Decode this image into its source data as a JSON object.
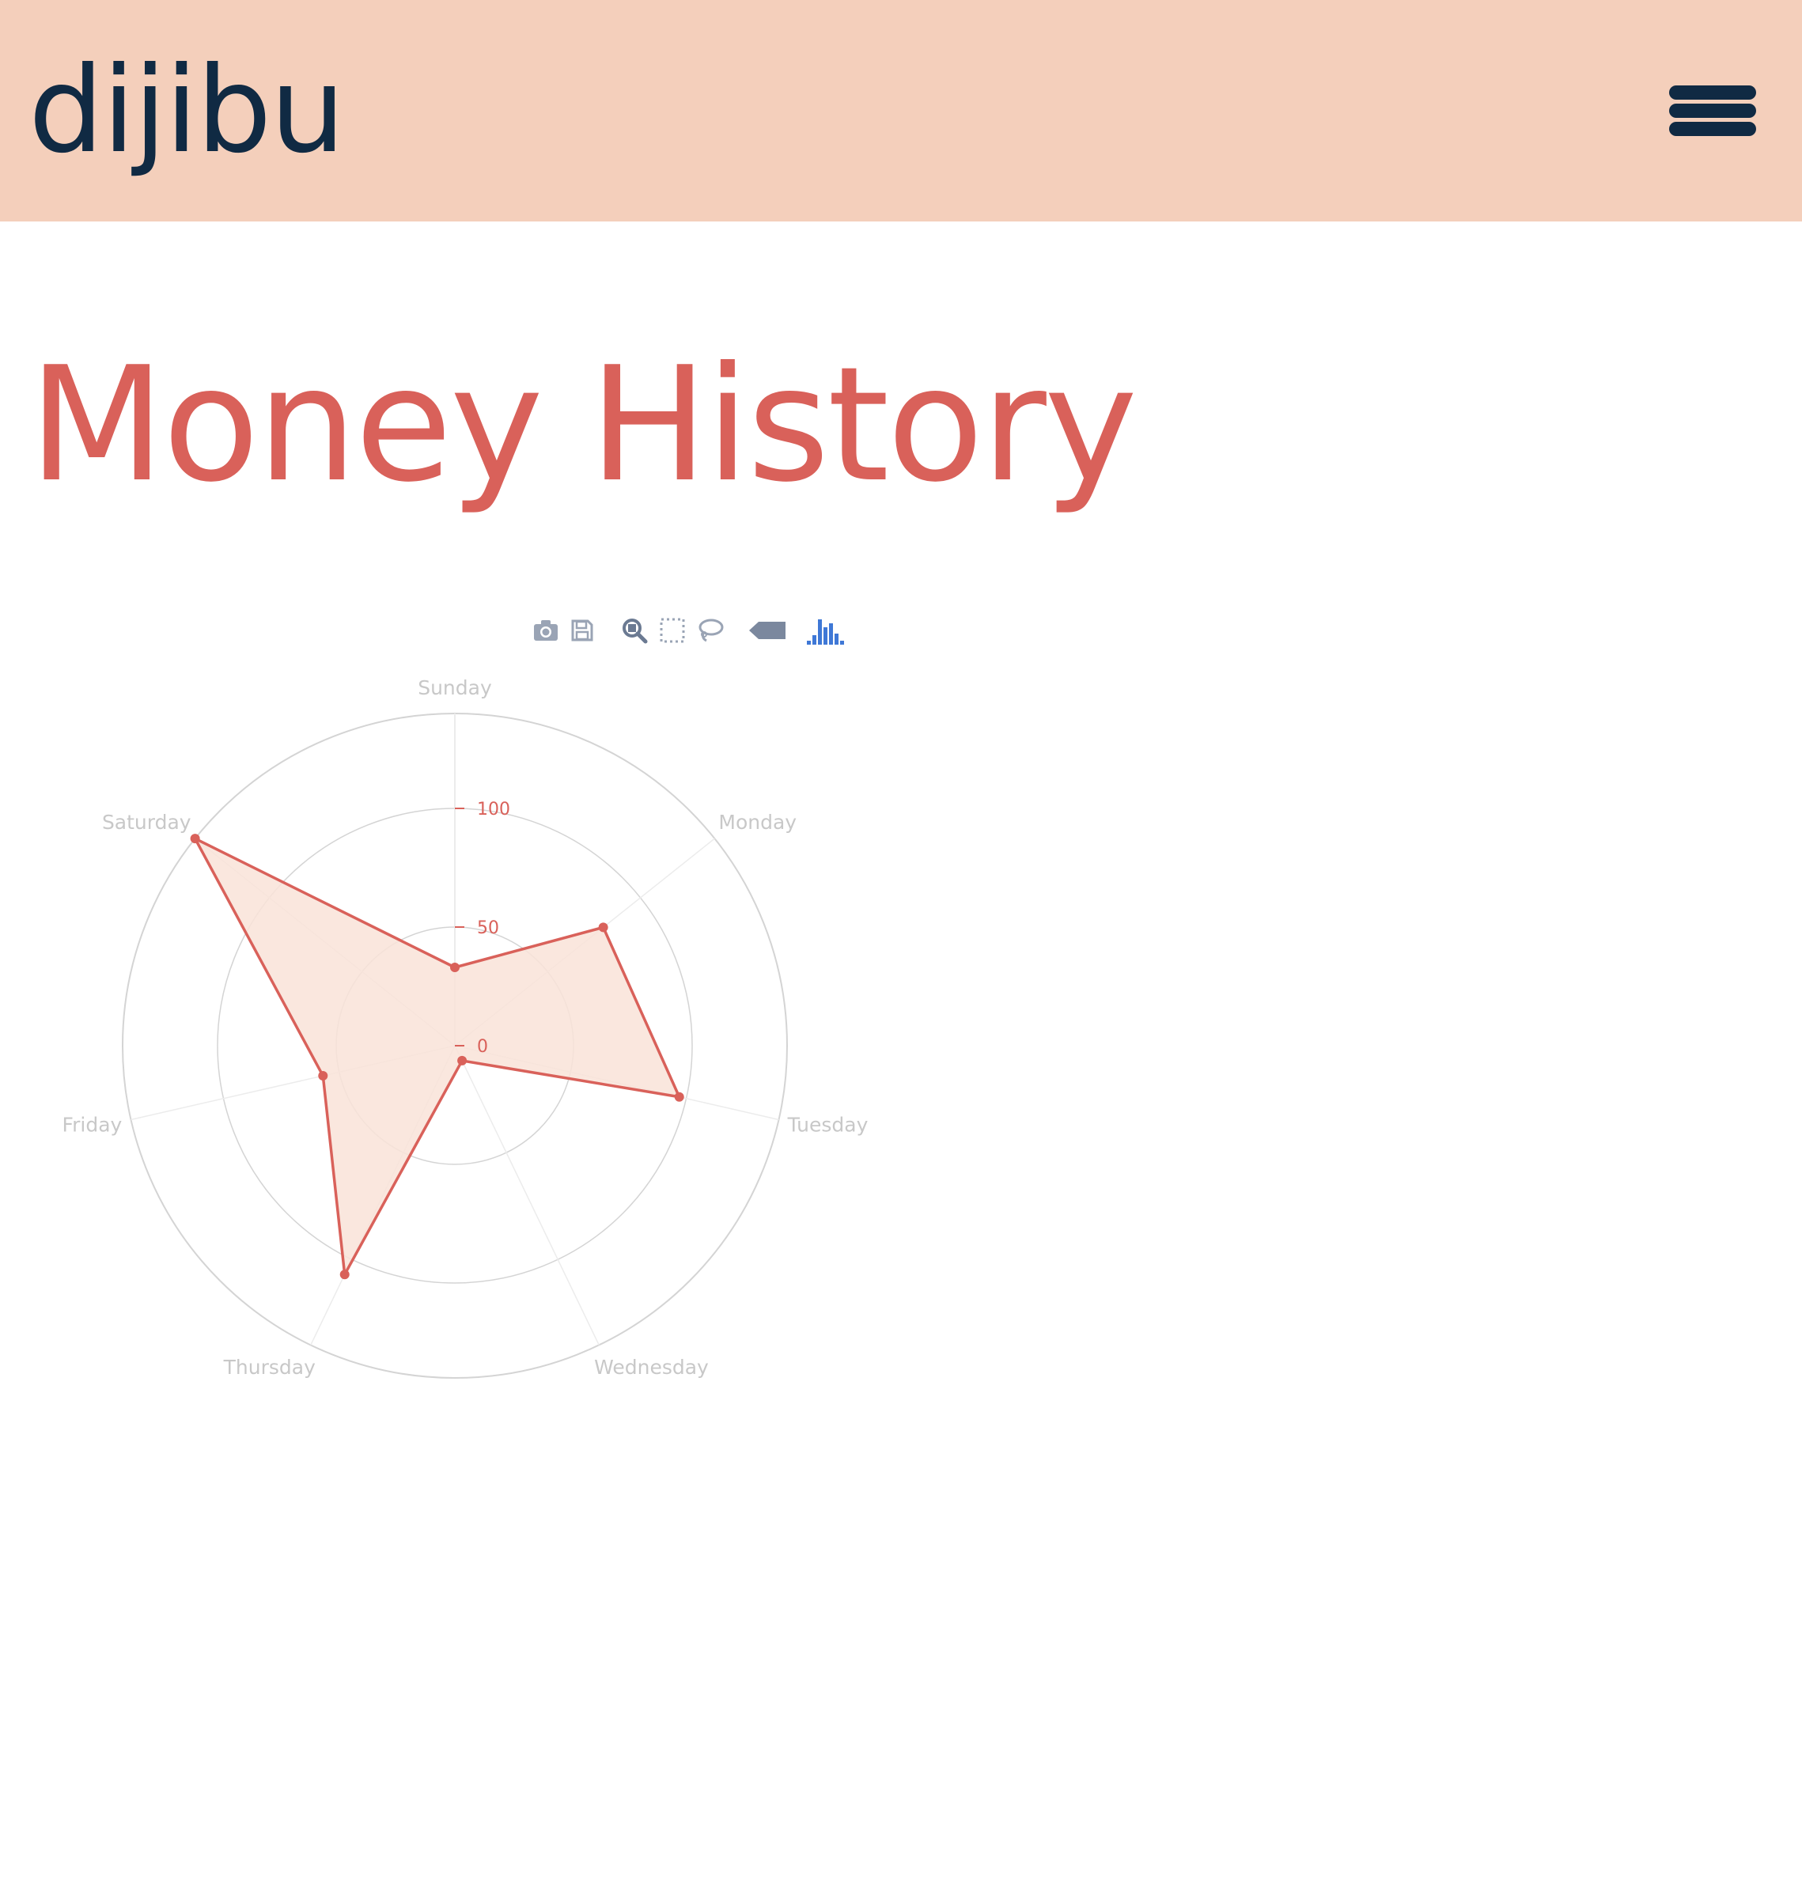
{
  "header": {
    "logo": "dijibu",
    "menu_icon": "hamburger-menu-icon"
  },
  "main": {
    "title": "Money History"
  },
  "toolbar": {
    "buttons": [
      {
        "icon": "camera-icon",
        "action": "download-plot"
      },
      {
        "icon": "save-icon",
        "action": "save"
      },
      {
        "icon": "zoom-icon",
        "action": "zoom"
      },
      {
        "icon": "box-select-icon",
        "action": "box-select"
      },
      {
        "icon": "lasso-select-icon",
        "action": "lasso-select"
      },
      {
        "icon": "hover-closest-icon",
        "action": "hover-closest"
      },
      {
        "icon": "plotly-logo-icon",
        "action": "plotly-link"
      }
    ]
  },
  "colors": {
    "header_bg": "#f4cfbb",
    "logo": "#102a43",
    "accent": "#d9615a",
    "fill": "#f9e3d8",
    "grid": "#d4d4d4",
    "axis_label": "#c8c8c8"
  },
  "chart_data": {
    "type": "radar",
    "categories": [
      "Sunday",
      "Monday",
      "Tuesday",
      "Wednesday",
      "Thursday",
      "Friday",
      "Saturday"
    ],
    "values": [
      33,
      80,
      97,
      7,
      107,
      57,
      140
    ],
    "radial_ticks": [
      0,
      50,
      100
    ],
    "radial_range": [
      0,
      140
    ],
    "grid": true
  }
}
